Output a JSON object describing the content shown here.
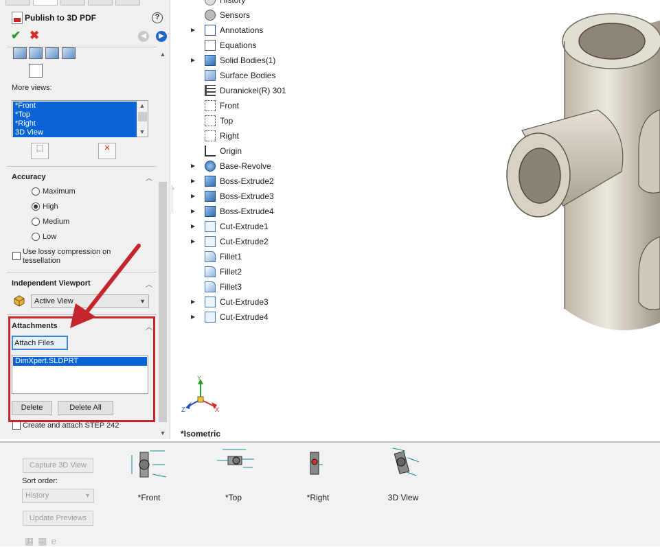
{
  "panel": {
    "title": "Publish to 3D PDF",
    "help_label": "?",
    "more_views_label": "More views:",
    "more_views_items": [
      "*Front",
      "*Top",
      "*Right",
      "3D View"
    ],
    "accuracy": {
      "title": "Accuracy",
      "options": [
        "Maximum",
        "High",
        "Medium",
        "Low"
      ],
      "selected": "High"
    },
    "lossy_label": "Use lossy compression on tessellation",
    "viewport": {
      "title": "Independent Viewport",
      "selected": "Active View"
    },
    "attachments": {
      "title": "Attachments",
      "attach_button": "Attach Files",
      "files": [
        "DimXpert.SLDPRT"
      ],
      "delete_button": "Delete",
      "delete_all_button": "Delete All"
    },
    "step_label": "Create and attach STEP 242"
  },
  "tree": {
    "items": [
      {
        "label": "History",
        "icon": "history-icon",
        "expand": false
      },
      {
        "label": "Sensors",
        "icon": "sensor-icon",
        "expand": false
      },
      {
        "label": "Annotations",
        "icon": "annotation-icon",
        "expand": true
      },
      {
        "label": "Equations",
        "icon": "equation-icon",
        "expand": false
      },
      {
        "label": "Solid Bodies(1)",
        "icon": "solid-bodies-icon",
        "expand": true
      },
      {
        "label": "Surface Bodies",
        "icon": "surface-bodies-icon",
        "expand": false
      },
      {
        "label": "Duranickel(R) 301",
        "icon": "material-icon",
        "expand": false
      },
      {
        "label": "Front",
        "icon": "plane-icon",
        "expand": false
      },
      {
        "label": "Top",
        "icon": "plane-icon",
        "expand": false
      },
      {
        "label": "Right",
        "icon": "plane-icon",
        "expand": false
      },
      {
        "label": "Origin",
        "icon": "origin-icon",
        "expand": false
      },
      {
        "label": "Base-Revolve",
        "icon": "revolve-icon",
        "expand": true
      },
      {
        "label": "Boss-Extrude2",
        "icon": "extrude-icon",
        "expand": true
      },
      {
        "label": "Boss-Extrude3",
        "icon": "extrude-icon",
        "expand": true
      },
      {
        "label": "Boss-Extrude4",
        "icon": "extrude-icon",
        "expand": true
      },
      {
        "label": "Cut-Extrude1",
        "icon": "cut-extrude-icon",
        "expand": true
      },
      {
        "label": "Cut-Extrude2",
        "icon": "cut-extrude-icon",
        "expand": true
      },
      {
        "label": "Fillet1",
        "icon": "fillet-icon",
        "expand": false
      },
      {
        "label": "Fillet2",
        "icon": "fillet-icon",
        "expand": false
      },
      {
        "label": "Fillet3",
        "icon": "fillet-icon",
        "expand": false
      },
      {
        "label": "Cut-Extrude3",
        "icon": "cut-extrude-icon",
        "expand": true
      },
      {
        "label": "Cut-Extrude4",
        "icon": "cut-extrude-icon",
        "expand": true
      }
    ]
  },
  "viewport": {
    "view_label": "*Isometric",
    "axis_x": "X",
    "axis_y": "Y",
    "axis_z": "Z"
  },
  "bottom": {
    "capture_button": "Capture 3D View",
    "sort_label": "Sort order:",
    "sort_value": "History",
    "update_button": "Update Previews",
    "thumbnails": [
      "*Front",
      "*Top",
      "*Right",
      "3D View"
    ]
  },
  "colors": {
    "selection": "#0a64d6",
    "highlight_box": "#c4262e",
    "part_body": "#d9d4c8"
  }
}
